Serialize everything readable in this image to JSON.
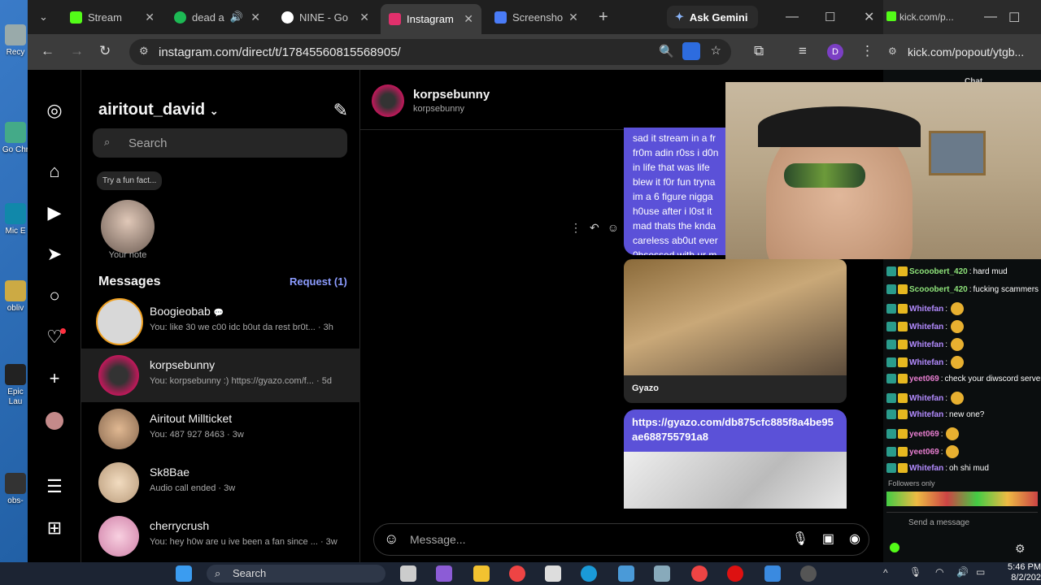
{
  "desktop": {
    "icons": [
      "Recy",
      "Go Chr",
      "Mic E",
      "obliv",
      "Epic Lau",
      "obs-"
    ]
  },
  "browser": {
    "tabs": [
      {
        "label": "Stream",
        "favicon_color": "#53fc18",
        "active": false
      },
      {
        "label": "dead a",
        "favicon_color": "#1db954",
        "active": false
      },
      {
        "label": "NINE - Go",
        "favicon_color": "#4285f4",
        "active": false
      },
      {
        "label": "Instagram",
        "favicon_color": "#e1306c",
        "active": true
      },
      {
        "label": "Screensho",
        "favicon_color": "#4a7cf7",
        "active": false
      }
    ],
    "ask_gemini": "Ask Gemini",
    "url": "instagram.com/direct/t/17845560815568905/",
    "profile_initial": "D"
  },
  "instagram": {
    "username": "airitout_david",
    "search_placeholder": "Search",
    "note_bubble": "Try a fun fact...",
    "note_label": "Your note",
    "messages_heading": "Messages",
    "request_link": "Request (1)",
    "threads": [
      {
        "name": "Boogieobab",
        "preview": "You: like 30 we c00 idc b0ut da rest br0t... · 3h",
        "avatar_color": "#d8d8d8",
        "selected": false
      },
      {
        "name": "korpsebunny",
        "preview": "You: korpsebunny :) https://gyazo.com/f... · 5d",
        "avatar_color": "#c2185b",
        "selected": true
      },
      {
        "name": "Airitout Millticket",
        "preview": "You: 487 927 8463 · 3w",
        "avatar_color": "#c9a07a",
        "selected": false
      },
      {
        "name": "Sk8Bae",
        "preview": "Audio call ended · 3w",
        "avatar_color": "#e8d3b5",
        "selected": false
      },
      {
        "name": "cherrycrush",
        "preview": "You: hey h0w are u ive been a fan since ... · 3w",
        "avatar_color": "#f4b6cf",
        "selected": false
      }
    ],
    "chat": {
      "name": "korpsebunny",
      "handle": "korpsebunny",
      "message_lines": [
        "sad it stream in a fr",
        "fr0m adin r0ss i d0n",
        "in life that was life",
        "blew it f0r fun tryna",
        "im a 6 figure nigga",
        "h0use after i l0st it",
        "mad thats the knda",
        "careless ab0ut ever",
        "0bsessed with ur m"
      ],
      "image_caption": "Gyazo",
      "link_message": "https://gyazo.com/db875cfc885f8a4be95ae688755791a8",
      "composer_placeholder": "Message..."
    }
  },
  "kick": {
    "tab_title": "kick.com/p...",
    "url": "kick.com/popout/ytgb...",
    "header": "Chat",
    "lines": [
      {
        "user": "Scooobert_420",
        "text": "hard mud",
        "color": "#8ee37a"
      },
      {
        "user": "Scooobert_420",
        "text": "fucking scammers",
        "color": "#8ee37a"
      },
      {
        "user": "Whitefan",
        "text": "",
        "color": "#b38bff"
      },
      {
        "user": "Whitefan",
        "text": "",
        "color": "#b38bff"
      },
      {
        "user": "Whitefan",
        "text": "",
        "color": "#b38bff"
      },
      {
        "user": "Whitefan",
        "text": "",
        "color": "#b38bff"
      },
      {
        "user": "yeet069",
        "text": "check your diwscord server",
        "color": "#e77ed0"
      },
      {
        "user": "Whitefan",
        "text": "",
        "color": "#b38bff"
      },
      {
        "user": "Whitefan",
        "text": "new one?",
        "color": "#b38bff"
      },
      {
        "user": "yeet069",
        "text": "",
        "color": "#e77ed0"
      },
      {
        "user": "yeet069",
        "text": "",
        "color": "#e77ed0"
      },
      {
        "user": "Whitefan",
        "text": "oh shi mud",
        "color": "#b38bff"
      }
    ],
    "followers_only": "Followers only",
    "send_placeholder": "Send a message"
  },
  "taskbar": {
    "search": "Search",
    "time": "5:46 PM",
    "date": "8/2/202"
  }
}
